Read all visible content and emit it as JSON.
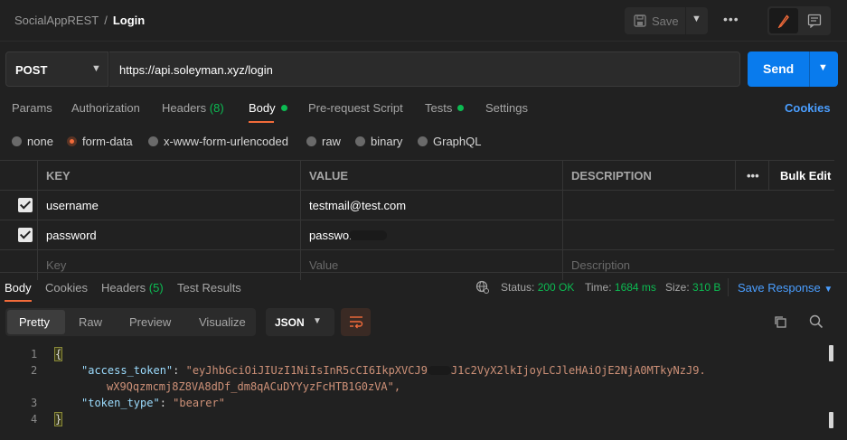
{
  "header": {
    "collection": "SocialAppREST",
    "separator": "/",
    "request_name": "Login",
    "save_label": "Save"
  },
  "request": {
    "method": "POST",
    "url": "https://api.soleyman.xyz/login",
    "send_label": "Send"
  },
  "request_tabs": [
    {
      "label": "Params"
    },
    {
      "label": "Authorization"
    },
    {
      "label": "Headers",
      "count": "(8)"
    },
    {
      "label": "Body"
    },
    {
      "label": "Pre-request Script"
    },
    {
      "label": "Tests"
    },
    {
      "label": "Settings"
    }
  ],
  "cookies_label": "Cookies",
  "body_types": [
    "none",
    "form-data",
    "x-www-form-urlencoded",
    "raw",
    "binary",
    "GraphQL"
  ],
  "selected_body_type": "form-data",
  "params_table": {
    "columns": [
      "KEY",
      "VALUE",
      "DESCRIPTION"
    ],
    "more": "•••",
    "bulk_edit": "Bulk Edit",
    "rows": [
      {
        "key": "username",
        "value": "testmail@test.com",
        "checked": true
      },
      {
        "key": "password",
        "value": "passwor",
        "checked": true
      }
    ],
    "placeholders": {
      "key": "Key",
      "value": "Value",
      "description": "Description"
    }
  },
  "response": {
    "tabs": [
      {
        "label": "Body"
      },
      {
        "label": "Cookies"
      },
      {
        "label": "Headers",
        "count": "(5)"
      },
      {
        "label": "Test Results"
      }
    ],
    "status_label": "Status:",
    "status": "200 OK",
    "time_label": "Time:",
    "time": "1684 ms",
    "size_label": "Size:",
    "size": "310 B",
    "save_response": "Save Response",
    "view_modes": [
      "Pretty",
      "Raw",
      "Preview",
      "Visualize"
    ],
    "format": "JSON",
    "lines": [
      {
        "n": "1",
        "text": "{"
      },
      {
        "n": "2",
        "key": "\"access_token\"",
        "val_a": "\"eyJhbGciOiJIUzI1NiIsInR5cCI6IkpXVCJ9",
        "val_b": "J1c2VyX2lkIjoyLCJleHAiOjE2NjA0MTkyNzJ9.",
        "val_c": "wX9Qqzmcmj8Z8VA8dDf_dm8qACuDYYyzFcHTB1G0zVA\","
      },
      {
        "n": "3",
        "key": "\"token_type\"",
        "val": "\"bearer\""
      },
      {
        "n": "4",
        "text": "}"
      }
    ]
  },
  "colors": {
    "accent": "#f26b3a",
    "send": "#097bed",
    "success": "#0cbb52",
    "link": "#4a9eff"
  }
}
